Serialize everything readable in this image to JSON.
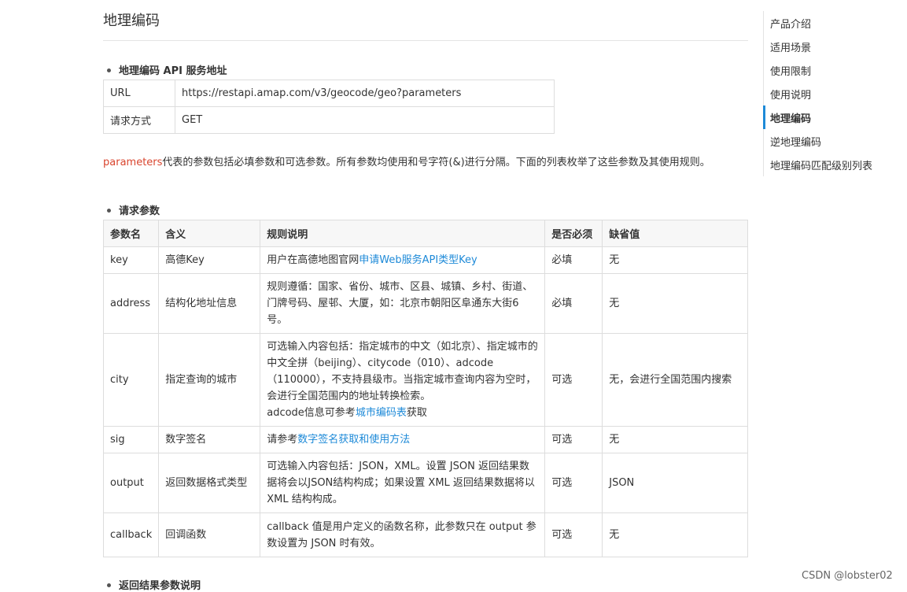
{
  "page": {
    "title": "地理编码",
    "watermark": "CSDN @lobster02"
  },
  "section1": {
    "title": "地理编码 API 服务地址"
  },
  "url_table": [
    {
      "label": "URL",
      "value": "https://restapi.amap.com/v3/geocode/geo?parameters"
    },
    {
      "label": "请求方式",
      "value": "GET"
    }
  ],
  "desc": {
    "keyword": "parameters",
    "text": "代表的参数包括必填参数和可选参数。所有参数均使用和号字符(&)进行分隔。下面的列表枚举了这些参数及其使用规则。"
  },
  "section2": {
    "title": "请求参数"
  },
  "param_table": {
    "headers": [
      "参数名",
      "含义",
      "规则说明",
      "是否必须",
      "缺省值"
    ],
    "rows": [
      {
        "name": "key",
        "meaning": "高德Key",
        "rule_pre": "用户在高德地图官网",
        "rule_link": "申请Web服务API类型Key",
        "rule_post": "",
        "required": "必填",
        "default": "无"
      },
      {
        "name": "address",
        "meaning": "结构化地址信息",
        "rule_pre": "规则遵循：国家、省份、城市、区县、城镇、乡村、街道、门牌号码、屋邨、大厦，如：北京市朝阳区阜通东大街6号。",
        "rule_link": "",
        "rule_post": "",
        "required": "必填",
        "default": "无"
      },
      {
        "name": "city",
        "meaning": "指定查询的城市",
        "rule_pre": "可选输入内容包括：指定城市的中文（如北京）、指定城市的中文全拼（beijing）、citycode（010）、adcode（110000），不支持县级市。当指定城市查询内容为空时，会进行全国范围内的地址转换检索。",
        "rule_line2": "adcode信息可参考",
        "rule_link": "城市编码表",
        "rule_post": "获取",
        "required": "可选",
        "default": "无，会进行全国范围内搜索"
      },
      {
        "name": "sig",
        "meaning": "数字签名",
        "rule_pre": "请参考",
        "rule_link": "数字签名获取和使用方法",
        "rule_post": "",
        "required": "可选",
        "default": "无"
      },
      {
        "name": "output",
        "meaning": "返回数据格式类型",
        "rule_pre": "可选输入内容包括：JSON，XML。设置 JSON 返回结果数据将会以JSON结构构成；如果设置 XML 返回结果数据将以 XML 结构构成。",
        "rule_link": "",
        "rule_post": "",
        "required": "可选",
        "default": "JSON"
      },
      {
        "name": "callback",
        "meaning": "回调函数",
        "rule_pre": "callback 值是用户定义的函数名称，此参数只在 output 参数设置为 JSON 时有效。",
        "rule_link": "",
        "rule_post": "",
        "required": "可选",
        "default": "无"
      }
    ]
  },
  "section3": {
    "title": "返回结果参数说明"
  },
  "toc": {
    "items": [
      "产品介绍",
      "适用场景",
      "使用限制",
      "使用说明",
      "地理编码",
      "逆地理编码",
      "地理编码匹配级别列表"
    ],
    "active_index": 4,
    "accent": "#1e8ad8"
  }
}
